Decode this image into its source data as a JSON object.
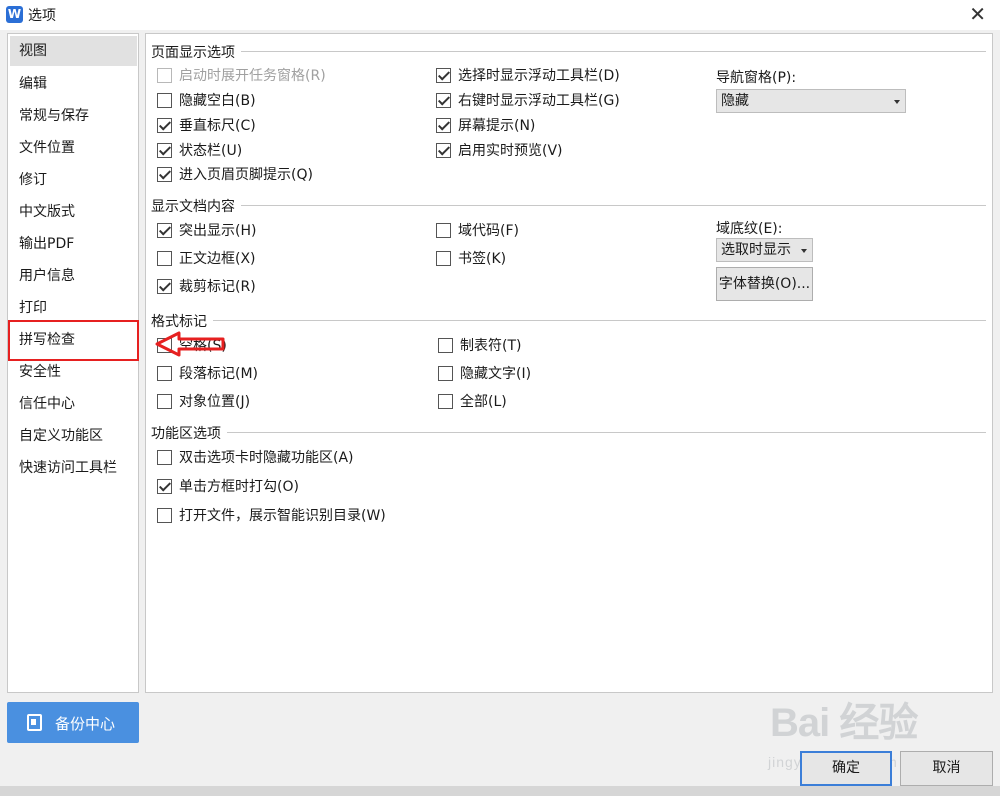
{
  "window": {
    "title": "选项",
    "app_icon": "W",
    "close": "✕"
  },
  "sidebar": {
    "items": [
      {
        "label": "视图",
        "state": "selected"
      },
      {
        "label": "编辑"
      },
      {
        "label": "常规与保存"
      },
      {
        "label": "文件位置"
      },
      {
        "label": "修订"
      },
      {
        "label": "中文版式"
      },
      {
        "label": "输出PDF"
      },
      {
        "label": "用户信息"
      },
      {
        "label": "打印"
      },
      {
        "label": "拼写检查",
        "state": "highlighted"
      },
      {
        "label": "安全性"
      },
      {
        "label": "信任中心"
      },
      {
        "label": "自定义功能区"
      },
      {
        "label": "快速访问工具栏"
      }
    ],
    "backup_button": "备份中心"
  },
  "page_display": {
    "title": "页面显示选项",
    "options": [
      {
        "label": "启动时展开任务窗格(R)",
        "checked": false,
        "disabled": true
      },
      {
        "label": "隐藏空白(B)",
        "checked": false
      },
      {
        "label": "垂直标尺(C)",
        "checked": true
      },
      {
        "label": "状态栏(U)",
        "checked": true
      },
      {
        "label": "进入页眉页脚提示(Q)",
        "checked": true
      },
      {
        "label": "选择时显示浮动工具栏(D)",
        "checked": true
      },
      {
        "label": "右键时显示浮动工具栏(G)",
        "checked": true
      },
      {
        "label": "屏幕提示(N)",
        "checked": true
      },
      {
        "label": "启用实时预览(V)",
        "checked": true
      }
    ],
    "nav_pane_label": "导航窗格(P):",
    "nav_pane_value": "隐藏"
  },
  "doc_content": {
    "title": "显示文档内容",
    "options": [
      {
        "label": "突出显示(H)",
        "checked": true
      },
      {
        "label": "正文边框(X)",
        "checked": false
      },
      {
        "label": "裁剪标记(R)",
        "checked": true
      },
      {
        "label": "域代码(F)",
        "checked": false
      },
      {
        "label": "书签(K)",
        "checked": false
      }
    ],
    "field_shading_label": "域底纹(E):",
    "field_shading_value": "选取时显示",
    "font_sub_button": "字体替换(O)..."
  },
  "format_marks": {
    "title": "格式标记",
    "options": [
      {
        "label": "空格(S)",
        "checked": false
      },
      {
        "label": "段落标记(M)",
        "checked": false
      },
      {
        "label": "对象位置(J)",
        "checked": false
      },
      {
        "label": "制表符(T)",
        "checked": false
      },
      {
        "label": "隐藏文字(I)",
        "checked": false
      },
      {
        "label": "全部(L)",
        "checked": false
      }
    ]
  },
  "ribbon": {
    "title": "功能区选项",
    "options": [
      {
        "label": "双击选项卡时隐藏功能区(A)",
        "checked": false
      },
      {
        "label": "单击方框时打勾(O)",
        "checked": true
      },
      {
        "label": "打开文件，展示智能识别目录(W)",
        "checked": false
      }
    ]
  },
  "footer": {
    "ok": "确定",
    "cancel": "取消"
  },
  "annotation": {
    "color": "#e62020"
  },
  "watermark": {
    "brand": "Bai 经验",
    "url": "jingyan.baidu.com"
  }
}
